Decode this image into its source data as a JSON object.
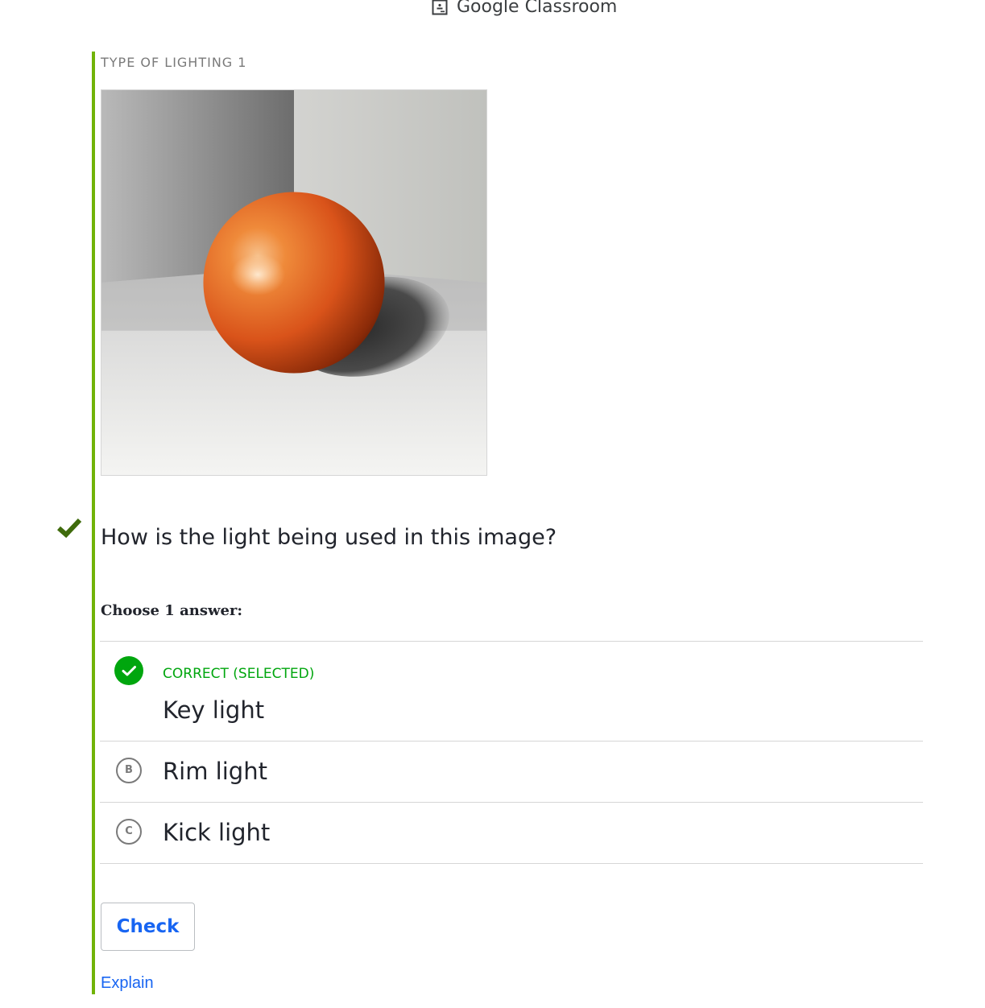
{
  "header": {
    "classroom_link": "Google Classroom",
    "classroom_icon": "google-classroom-icon"
  },
  "exercise": {
    "title": "TYPE OF LIGHTING 1",
    "image_icon": "orange-sphere-lighting-image",
    "status_icon": "checkmark-icon",
    "question": "How is the light being used in this image?",
    "instruction": "Choose 1 answer:",
    "choices": [
      {
        "letter": "A",
        "label": "Key light",
        "status": "CORRECT (SELECTED)",
        "selected": true,
        "correct": true
      },
      {
        "letter": "B",
        "label": "Rim light",
        "selected": false
      },
      {
        "letter": "C",
        "label": "Kick light",
        "selected": false
      }
    ],
    "check_button": "Check",
    "explain_link": "Explain"
  },
  "colors": {
    "accent_border": "#71b307",
    "correct_green": "#00a60e",
    "status_check": "#3f6b0c",
    "link_blue": "#1865f2",
    "text": "#21242c",
    "muted": "#7a7a7a",
    "divider": "#d6d6d6"
  }
}
